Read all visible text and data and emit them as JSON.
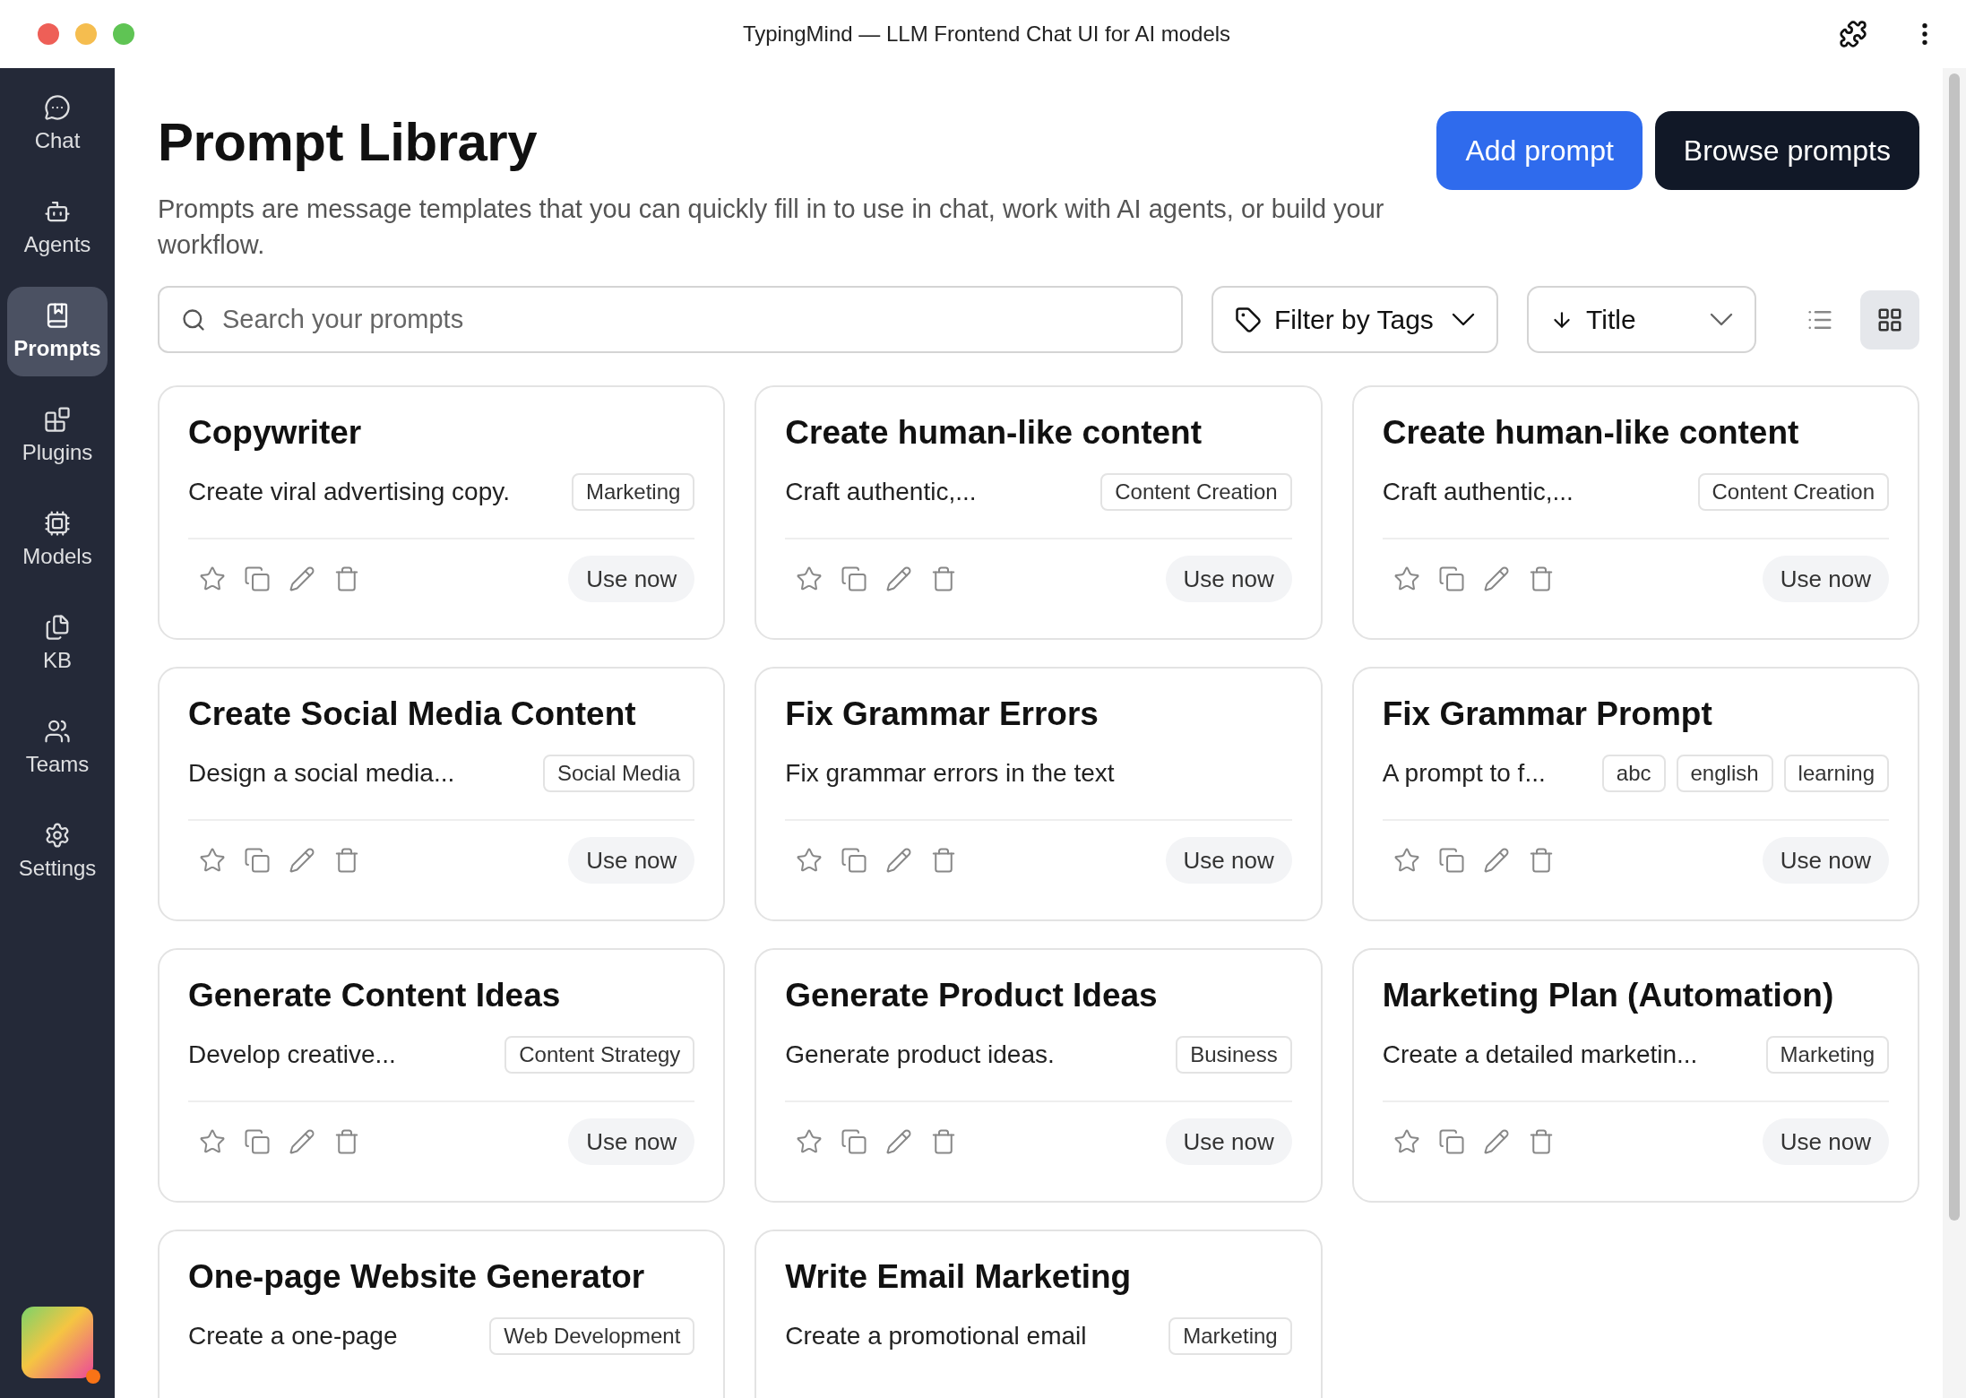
{
  "window": {
    "title": "TypingMind — LLM Frontend Chat UI for AI models"
  },
  "sidebar": {
    "items": [
      {
        "kind": "chat",
        "label": "Chat",
        "selected": false
      },
      {
        "kind": "agents",
        "label": "Agents",
        "selected": false
      },
      {
        "kind": "prompts",
        "label": "Prompts",
        "selected": true
      },
      {
        "kind": "plugins",
        "label": "Plugins",
        "selected": false
      },
      {
        "kind": "models",
        "label": "Models",
        "selected": false
      },
      {
        "kind": "kb",
        "label": "KB",
        "selected": false
      },
      {
        "kind": "teams",
        "label": "Teams",
        "selected": false
      },
      {
        "kind": "settings",
        "label": "Settings",
        "selected": false
      }
    ]
  },
  "header": {
    "title": "Prompt Library",
    "subtitle": "Prompts are message templates that you can quickly fill in to use in chat, work with AI agents, or build your workflow.",
    "buttons": [
      {
        "kind": "primary",
        "label": "Add prompt"
      },
      {
        "kind": "dark",
        "label": "Browse prompts"
      }
    ]
  },
  "toolbar": {
    "search": {
      "placeholder": "Search your prompts"
    },
    "filter": {
      "label": "Filter by Tags"
    },
    "sort": {
      "label": "Title"
    },
    "views": [
      {
        "kind": "list",
        "selected": false
      },
      {
        "kind": "grid",
        "selected": true
      }
    ]
  },
  "cards": [
    {
      "title": "Copywriter",
      "description": "Create viral advertising copy.",
      "tags": [
        "Marketing"
      ],
      "action": "Use now"
    },
    {
      "title": "Create human-like content",
      "description": "Craft authentic,...",
      "tags": [
        "Content Creation"
      ],
      "action": "Use now"
    },
    {
      "title": "Create human-like content",
      "description": "Craft authentic,...",
      "tags": [
        "Content Creation"
      ],
      "action": "Use now"
    },
    {
      "title": "Create Social Media Content",
      "description": "Design a social media...",
      "tags": [
        "Social Media"
      ],
      "action": "Use now"
    },
    {
      "title": "Fix Grammar Errors",
      "description": "Fix grammar errors in the text",
      "action": "Use now"
    },
    {
      "title": "Fix Grammar Prompt",
      "description": "A prompt to f...",
      "tags": [
        "abc",
        "english",
        "learning"
      ],
      "action": "Use now"
    },
    {
      "title": "Generate Content Ideas",
      "description": "Develop creative...",
      "tags": [
        "Content Strategy"
      ],
      "action": "Use now"
    },
    {
      "title": "Generate Product Ideas",
      "description": "Generate product ideas.",
      "tags": [
        "Business"
      ],
      "action": "Use now"
    },
    {
      "title": "Marketing Plan (Automation)",
      "description": "Create a detailed marketin...",
      "tags": [
        "Marketing"
      ],
      "action": "Use now"
    },
    {
      "title": "One-page Website Generator",
      "description": "Create a one-page",
      "tags": [
        "Web Development"
      ]
    },
    {
      "title": "Write Email Marketing",
      "description": "Create a promotional email",
      "tags": [
        "Marketing"
      ]
    }
  ]
}
